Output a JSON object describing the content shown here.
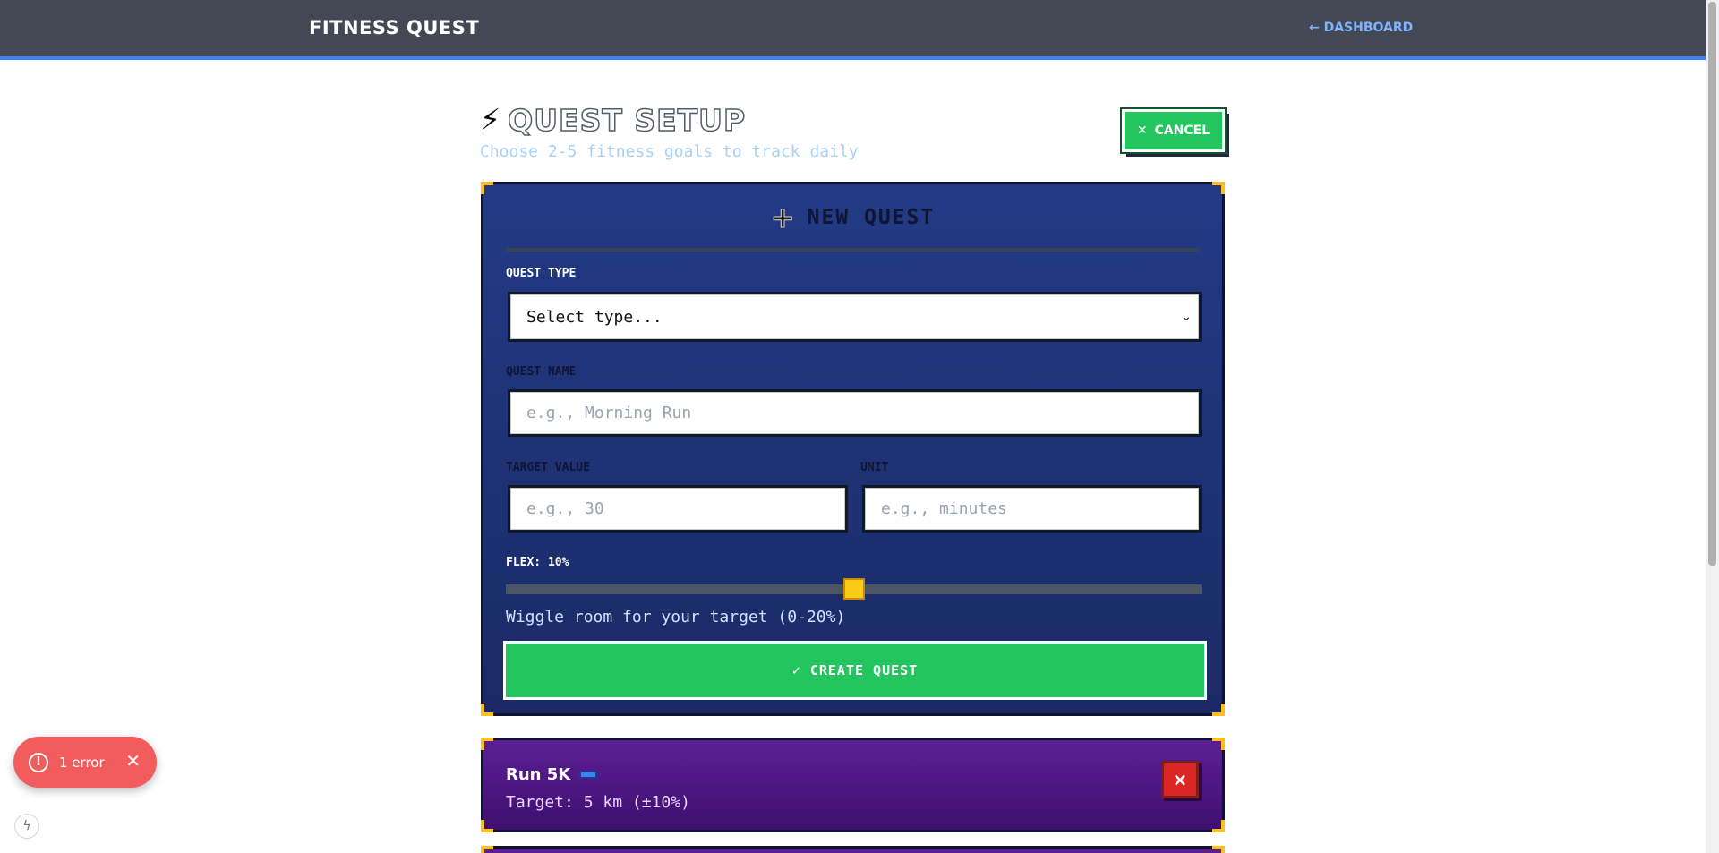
{
  "header": {
    "brand": "FITNESS QUEST",
    "dashboard_link": "← DASHBOARD"
  },
  "page": {
    "title_icon": "⚡",
    "title": "QUEST SETUP",
    "subtitle": "Choose 2-5 fitness goals to track daily",
    "cancel_icon": "✕",
    "cancel_label": "CANCEL"
  },
  "form": {
    "heading_icon": "+",
    "heading": "NEW QUEST",
    "type_label": "QUEST TYPE",
    "type_value": "Select type...",
    "name_label": "QUEST NAME",
    "name_placeholder": "e.g., Morning Run",
    "target_label": "TARGET VALUE",
    "target_placeholder": "e.g., 30",
    "unit_label": "UNIT",
    "unit_placeholder": "e.g., minutes",
    "flex_label": "FLEX: 10%",
    "flex_value": 0.5,
    "flex_hint": "Wiggle room for your target (0-20%)",
    "create_label": "✓ CREATE QUEST"
  },
  "quests": [
    {
      "name": "Run 5K",
      "target": "Target: 5 km (±10%)",
      "delete_label": "×"
    }
  ],
  "toast": {
    "icon": "!",
    "text": "1 error",
    "close": "✕"
  },
  "devtools": {
    "icon": "ϟ"
  },
  "colors": {
    "accent_blue": "#3b82f6",
    "success_green": "#22c55e",
    "danger_red": "#dc2626",
    "corner_gold": "#fbbf24",
    "quest_purple": "#5b1f93"
  }
}
